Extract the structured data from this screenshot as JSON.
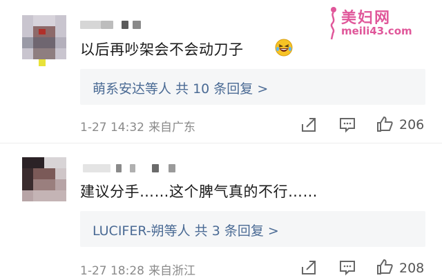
{
  "watermark": {
    "title": "美妇网",
    "url": "meili43.com"
  },
  "comments": [
    {
      "text": "以后再吵架会不会动刀子",
      "emoji": "laughing-crying-emoji",
      "reply_user": "萌系安达",
      "reply_suffix": "等人 共 10 条回复 >",
      "time": "1-27 14:32",
      "location": "来自广东",
      "likes": "206"
    },
    {
      "text": "建议分手……这个脾气真的不行……",
      "reply_user": "LUCIFER-朔",
      "reply_suffix": "等人 共 3 条回复 >",
      "time": "1-27 18:28",
      "location": "来自浙江",
      "likes": "208"
    }
  ],
  "icons": {
    "share": "share-icon",
    "comment": "comment-icon",
    "like": "thumbs-up-icon"
  },
  "colors": {
    "link": "#4a6a94",
    "meta": "#8a8a8a",
    "reply_bg": "#f5f6f7",
    "watermark": "#e0579a"
  }
}
